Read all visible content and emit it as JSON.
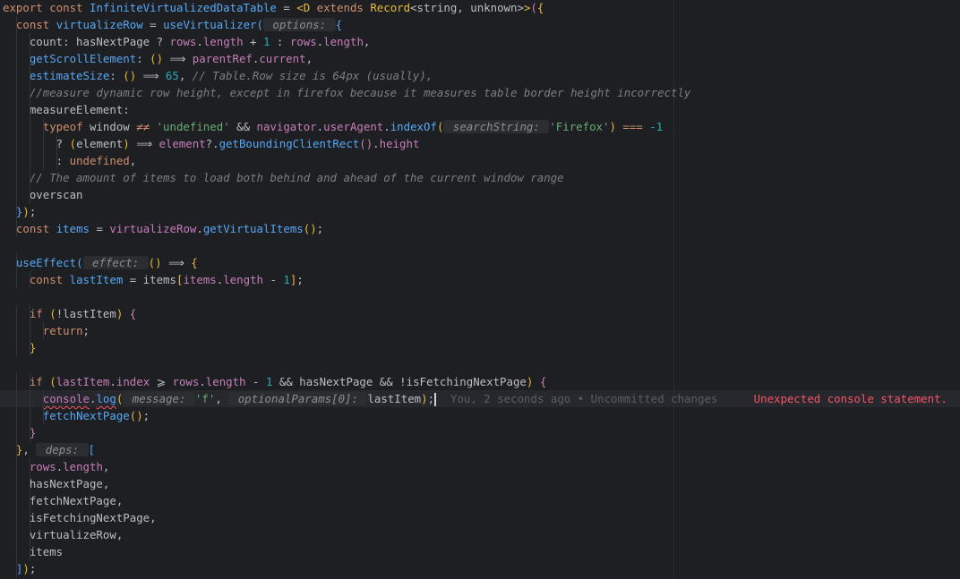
{
  "editor": {
    "lines": [
      [
        [
          "kw",
          "export "
        ],
        [
          "kw",
          "const "
        ],
        [
          "fn",
          "InfiniteVirtualizedDataTable"
        ],
        [
          "op",
          " = "
        ],
        [
          "b1",
          "<"
        ],
        [
          "type",
          "D "
        ],
        [
          "kw",
          "extends "
        ],
        [
          "type",
          "Record"
        ],
        [
          "op",
          "<string, unknown>"
        ],
        [
          "b1",
          ">"
        ],
        [
          "b2",
          "("
        ],
        [
          "b1",
          "{"
        ]
      ],
      [
        [
          "op",
          "  "
        ],
        [
          "kw",
          "const "
        ],
        [
          "fn",
          "virtualizeRow"
        ],
        [
          "op",
          " = "
        ],
        [
          "fn",
          "useVirtualizer"
        ],
        [
          "b3",
          "("
        ],
        [
          "hint",
          " options: "
        ],
        [
          "b3",
          "{"
        ]
      ],
      [
        [
          "op",
          "    count: hasNextPage ? "
        ],
        [
          "prop",
          "rows"
        ],
        [
          "op",
          "."
        ],
        [
          "prop",
          "length"
        ],
        [
          "op",
          " + "
        ],
        [
          "num",
          "1"
        ],
        [
          "op",
          " : "
        ],
        [
          "prop",
          "rows"
        ],
        [
          "op",
          "."
        ],
        [
          "prop",
          "length"
        ],
        [
          "op",
          ","
        ]
      ],
      [
        [
          "op",
          "    "
        ],
        [
          "fn",
          "getScrollElement"
        ],
        [
          "op",
          ": "
        ],
        [
          "b1",
          "()"
        ],
        [
          "op",
          " ⟹ "
        ],
        [
          "prop",
          "parentRef"
        ],
        [
          "op",
          "."
        ],
        [
          "prop",
          "current"
        ],
        [
          "op",
          ","
        ]
      ],
      [
        [
          "op",
          "    "
        ],
        [
          "fn",
          "estimateSize"
        ],
        [
          "op",
          ": "
        ],
        [
          "b1",
          "()"
        ],
        [
          "op",
          " ⟹ "
        ],
        [
          "num",
          "65"
        ],
        [
          "op",
          ", "
        ],
        [
          "cm",
          "// Table.Row size is 64px (usually),"
        ]
      ],
      [
        [
          "op",
          "    "
        ],
        [
          "cm",
          "//measure dynamic row height, except in firefox because it measures table border height incorrectly"
        ]
      ],
      [
        [
          "op",
          "    measureElement:"
        ]
      ],
      [
        [
          "op",
          "      "
        ],
        [
          "kw",
          "typeof "
        ],
        [
          "op",
          "window "
        ],
        [
          "kw",
          "≠≠ "
        ],
        [
          "str",
          "'undefined'"
        ],
        [
          "op",
          " && "
        ],
        [
          "prop",
          "navigator"
        ],
        [
          "op",
          "."
        ],
        [
          "prop",
          "userAgent"
        ],
        [
          "op",
          "."
        ],
        [
          "fn",
          "indexOf"
        ],
        [
          "b1",
          "("
        ],
        [
          "hint",
          " searchString: "
        ],
        [
          "str",
          "'Firefox'"
        ],
        [
          "b1",
          ")"
        ],
        [
          "op",
          " "
        ],
        [
          "kw",
          "==="
        ],
        [
          "op",
          " "
        ],
        [
          "num",
          "-1"
        ]
      ],
      [
        [
          "op",
          "        ? "
        ],
        [
          "b1",
          "("
        ],
        [
          "op",
          "element"
        ],
        [
          "b1",
          ")"
        ],
        [
          "op",
          " ⟹ "
        ],
        [
          "prop",
          "element"
        ],
        [
          "op",
          "?."
        ],
        [
          "fn",
          "getBoundingClientRect"
        ],
        [
          "b2",
          "()"
        ],
        [
          "op",
          "."
        ],
        [
          "prop",
          "height"
        ]
      ],
      [
        [
          "op",
          "        : "
        ],
        [
          "kw",
          "undefined"
        ],
        [
          "op",
          ","
        ]
      ],
      [
        [
          "op",
          "    "
        ],
        [
          "cm",
          "// The amount of items to load both behind and ahead of the current window range"
        ]
      ],
      [
        [
          "op",
          "    overscan"
        ]
      ],
      [
        [
          "op",
          "  "
        ],
        [
          "b3",
          "}"
        ],
        [
          "b1",
          ")"
        ],
        [
          "op",
          ";"
        ]
      ],
      [
        [
          "op",
          "  "
        ],
        [
          "kw",
          "const "
        ],
        [
          "fn",
          "items"
        ],
        [
          "op",
          " = "
        ],
        [
          "prop",
          "virtualizeRow"
        ],
        [
          "op",
          "."
        ],
        [
          "fn",
          "getVirtualItems"
        ],
        [
          "b1",
          "()"
        ],
        [
          "op",
          ";"
        ]
      ],
      [
        [
          "op",
          ""
        ]
      ],
      [
        [
          "op",
          "  "
        ],
        [
          "fn",
          "useEffect"
        ],
        [
          "b3",
          "("
        ],
        [
          "hint",
          " effect: "
        ],
        [
          "b1",
          "()"
        ],
        [
          "op",
          " ⟹ "
        ],
        [
          "b1",
          "{"
        ]
      ],
      [
        [
          "op",
          "    "
        ],
        [
          "kw",
          "const "
        ],
        [
          "fn",
          "lastItem"
        ],
        [
          "op",
          " = items"
        ],
        [
          "b1",
          "["
        ],
        [
          "prop",
          "items"
        ],
        [
          "op",
          "."
        ],
        [
          "prop",
          "length"
        ],
        [
          "op",
          " - "
        ],
        [
          "num",
          "1"
        ],
        [
          "b1",
          "]"
        ],
        [
          "op",
          ";"
        ]
      ],
      [
        [
          "op",
          ""
        ]
      ],
      [
        [
          "op",
          "    "
        ],
        [
          "kw",
          "if "
        ],
        [
          "b1",
          "("
        ],
        [
          "op",
          "!lastItem"
        ],
        [
          "b1",
          ")"
        ],
        [
          "op",
          " "
        ],
        [
          "b2",
          "{"
        ]
      ],
      [
        [
          "op",
          "      "
        ],
        [
          "kw",
          "return"
        ],
        [
          "op",
          ";"
        ]
      ],
      [
        [
          "op",
          "    "
        ],
        [
          "b1",
          "}"
        ]
      ],
      [
        [
          "op",
          ""
        ]
      ],
      [
        [
          "op",
          "    "
        ],
        [
          "kw",
          "if "
        ],
        [
          "b1",
          "("
        ],
        [
          "prop",
          "lastItem"
        ],
        [
          "op",
          "."
        ],
        [
          "prop",
          "index"
        ],
        [
          "op",
          " ⩾ "
        ],
        [
          "prop",
          "rows"
        ],
        [
          "op",
          "."
        ],
        [
          "prop",
          "length"
        ],
        [
          "op",
          " - "
        ],
        [
          "num",
          "1"
        ],
        [
          "op",
          " && hasNextPage && !isFetchingNextPage"
        ],
        [
          "b1",
          ")"
        ],
        [
          "op",
          " "
        ],
        [
          "b2",
          "{"
        ]
      ],
      [
        [
          "op",
          "      "
        ],
        [
          "prop",
          "console"
        ],
        [
          "op",
          "."
        ],
        [
          "fn",
          "log"
        ],
        [
          "b1",
          "("
        ],
        [
          "hint",
          " message: "
        ],
        [
          "str",
          "'f'"
        ],
        [
          "op",
          ", "
        ],
        [
          "hint",
          " optionalParams[0]: "
        ],
        [
          "op",
          "lastItem"
        ],
        [
          "b1",
          ")"
        ],
        [
          "op",
          ";"
        ]
      ],
      [
        [
          "op",
          "      "
        ],
        [
          "fn",
          "fetchNextPage"
        ],
        [
          "b1",
          "()"
        ],
        [
          "op",
          ";"
        ]
      ],
      [
        [
          "op",
          "    "
        ],
        [
          "b2",
          "}"
        ]
      ],
      [
        [
          "op",
          "  "
        ],
        [
          "b1",
          "}"
        ],
        [
          "op",
          ", "
        ],
        [
          "hint",
          " deps: "
        ],
        [
          "b3",
          "["
        ]
      ],
      [
        [
          "op",
          "    "
        ],
        [
          "prop",
          "rows"
        ],
        [
          "op",
          "."
        ],
        [
          "prop",
          "length"
        ],
        [
          "op",
          ","
        ]
      ],
      [
        [
          "op",
          "    hasNextPage,"
        ]
      ],
      [
        [
          "op",
          "    fetchNextPage,"
        ]
      ],
      [
        [
          "op",
          "    isFetchingNextPage,"
        ]
      ],
      [
        [
          "op",
          "    virtualizeRow,"
        ]
      ],
      [
        [
          "op",
          "    items"
        ]
      ],
      [
        [
          "op",
          "  "
        ],
        [
          "b3",
          "]"
        ],
        [
          "b1",
          ")"
        ],
        [
          "op",
          ";"
        ]
      ]
    ],
    "blame_text": "You, 2 seconds ago • Uncommitted changes",
    "error_text": "Unexpected console statement.",
    "colors": {
      "background": "#1e1f22",
      "keyword": "#cf8e6d",
      "function": "#56a8f5",
      "property": "#c77dbb",
      "string": "#6aab73",
      "number": "#2aacb8",
      "comment": "#7a7e85",
      "error": "#f75464"
    }
  }
}
